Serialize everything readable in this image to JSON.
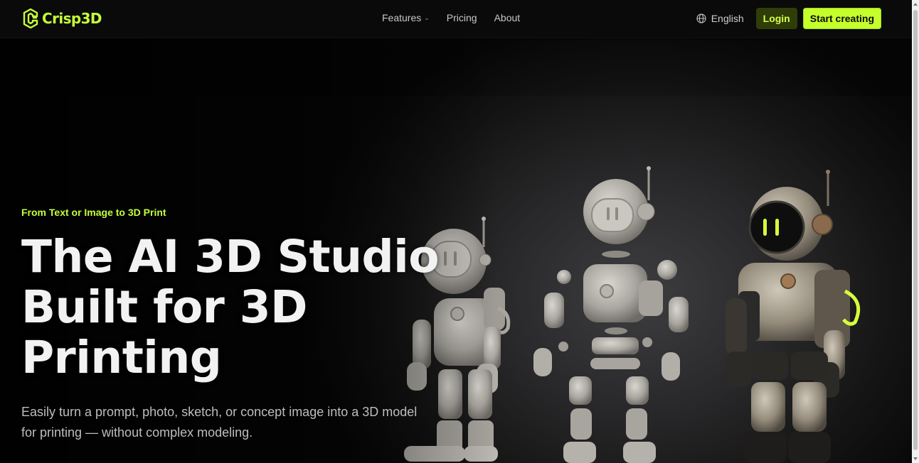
{
  "brand": {
    "name": "Crisp3D",
    "accent": "#c6ff3a"
  },
  "nav": {
    "links": [
      {
        "label": "Features",
        "dropdown": true
      },
      {
        "label": "Pricing"
      },
      {
        "label": "About"
      }
    ],
    "language": "English",
    "login_label": "Login",
    "cta_label": "Start creating"
  },
  "hero": {
    "tagline": "From Text or Image to 3D Print",
    "headline_lines": [
      "The AI 3D Studio",
      "Built for 3D",
      "Printing"
    ],
    "subtitle_lines": [
      "Easily turn a prompt, photo, sketch, or concept image into a 3D model",
      "for printing — without complex modeling."
    ],
    "image_icons": [
      "robot-astronaut-grey",
      "robot-exploded-parts",
      "robot-astronaut-weathered"
    ]
  }
}
